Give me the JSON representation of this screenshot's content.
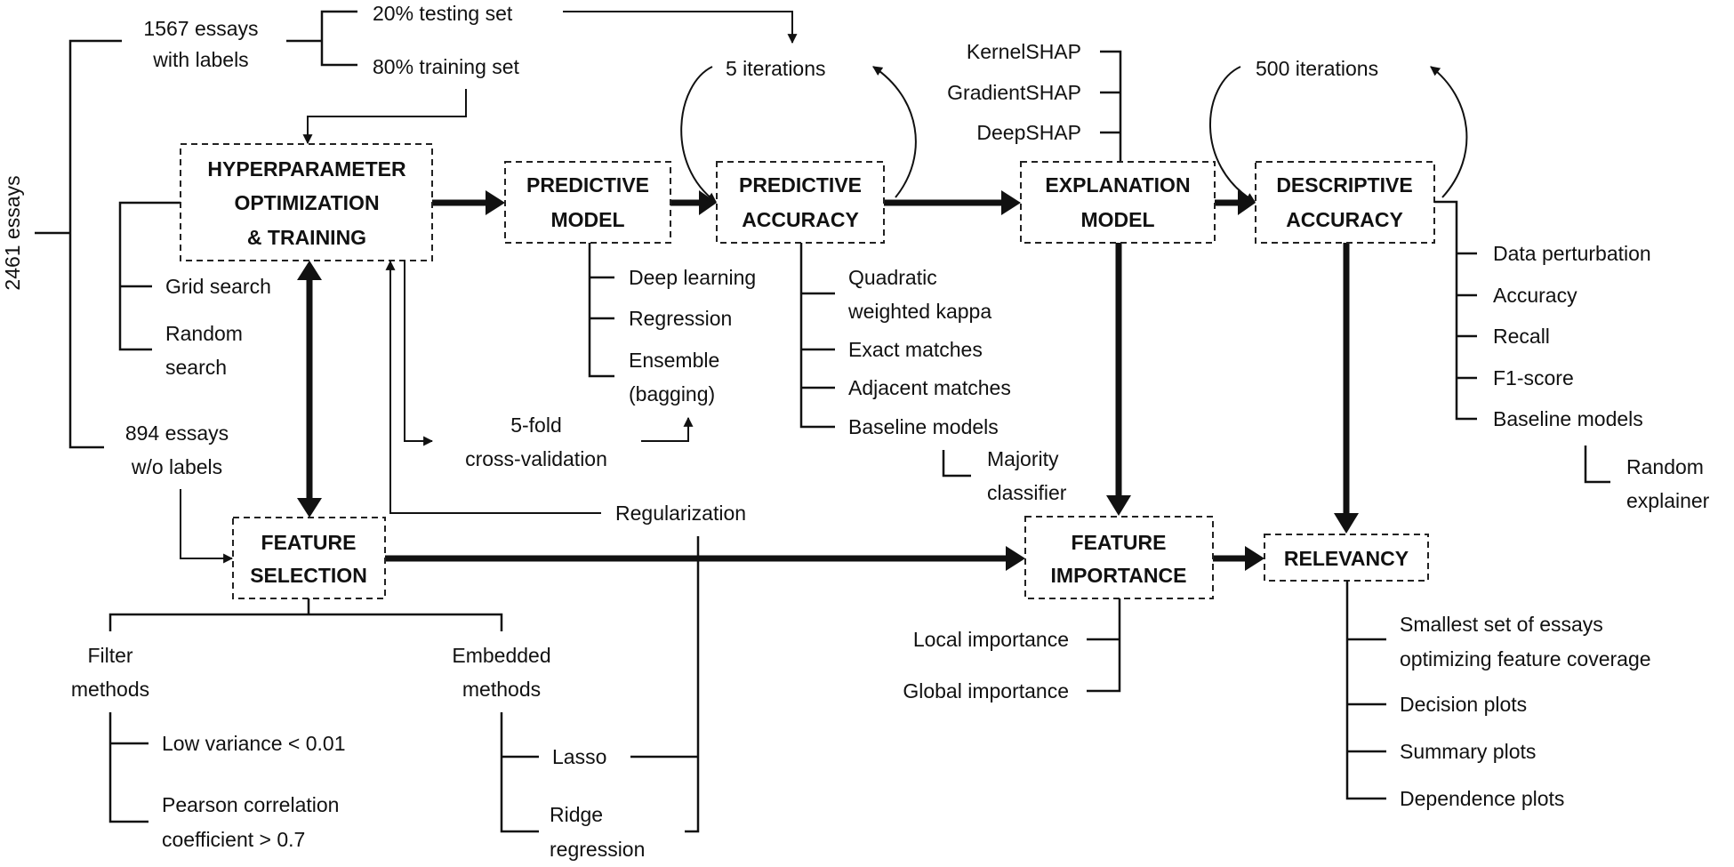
{
  "inputs": {
    "total": "2461 essays",
    "labeled": [
      "1567 essays",
      "with labels"
    ],
    "unlabeled": [
      "894 essays",
      "w/o labels"
    ],
    "testing": "20% testing set",
    "training": "80% training set"
  },
  "boxes": {
    "hyper": [
      "HYPERPARAMETER",
      "OPTIMIZATION",
      "& TRAINING"
    ],
    "predictive_model": [
      "PREDICTIVE",
      "MODEL"
    ],
    "predictive_accuracy": [
      "PREDICTIVE",
      "ACCURACY"
    ],
    "explanation_model": [
      "EXPLANATION",
      "MODEL"
    ],
    "descriptive_accuracy": [
      "DESCRIPTIVE",
      "ACCURACY"
    ],
    "feature_selection": [
      "FEATURE",
      "SELECTION"
    ],
    "feature_importance": [
      "FEATURE",
      "IMPORTANCE"
    ],
    "relevancy": "RELEVANCY"
  },
  "loops": {
    "predictive": "5 iterations",
    "descriptive": "500 iterations"
  },
  "hyper_methods": {
    "grid": "Grid search",
    "random": [
      "Random",
      "search"
    ],
    "cross_validation": [
      "5-fold",
      "cross-validation"
    ],
    "regularization": "Regularization"
  },
  "model_types": [
    "Deep learning",
    "Regression",
    "Ensemble",
    "(bagging)"
  ],
  "predictive_metrics": {
    "qwk": [
      "Quadratic",
      "weighted kappa"
    ],
    "exact": "Exact matches",
    "adjacent": "Adjacent matches",
    "baseline": "Baseline models",
    "baseline_sub": [
      "Majority",
      "classifier"
    ]
  },
  "explainers": [
    "KernelSHAP",
    "GradientSHAP",
    "DeepSHAP"
  ],
  "descriptive_metrics": {
    "items": [
      "Data perturbation",
      "Accuracy",
      "Recall",
      "F1-score",
      "Baseline models"
    ],
    "baseline_sub": [
      "Random",
      "explainer"
    ]
  },
  "importance": [
    "Local importance",
    "Global importance"
  ],
  "relevancy_items": {
    "smallest": [
      "Smallest set of essays",
      "optimizing feature coverage"
    ],
    "others": [
      "Decision plots",
      "Summary plots",
      "Dependence plots"
    ]
  },
  "feature_selection_methods": {
    "filter": [
      "Filter",
      "methods"
    ],
    "filter_items": {
      "low_variance": "Low variance < 0.01",
      "pearson": [
        "Pearson correlation",
        "coefficient > 0.7"
      ]
    },
    "embedded": [
      "Embedded",
      "methods"
    ],
    "embedded_items": {
      "lasso": "Lasso",
      "ridge": [
        "Ridge",
        "regression"
      ]
    }
  }
}
